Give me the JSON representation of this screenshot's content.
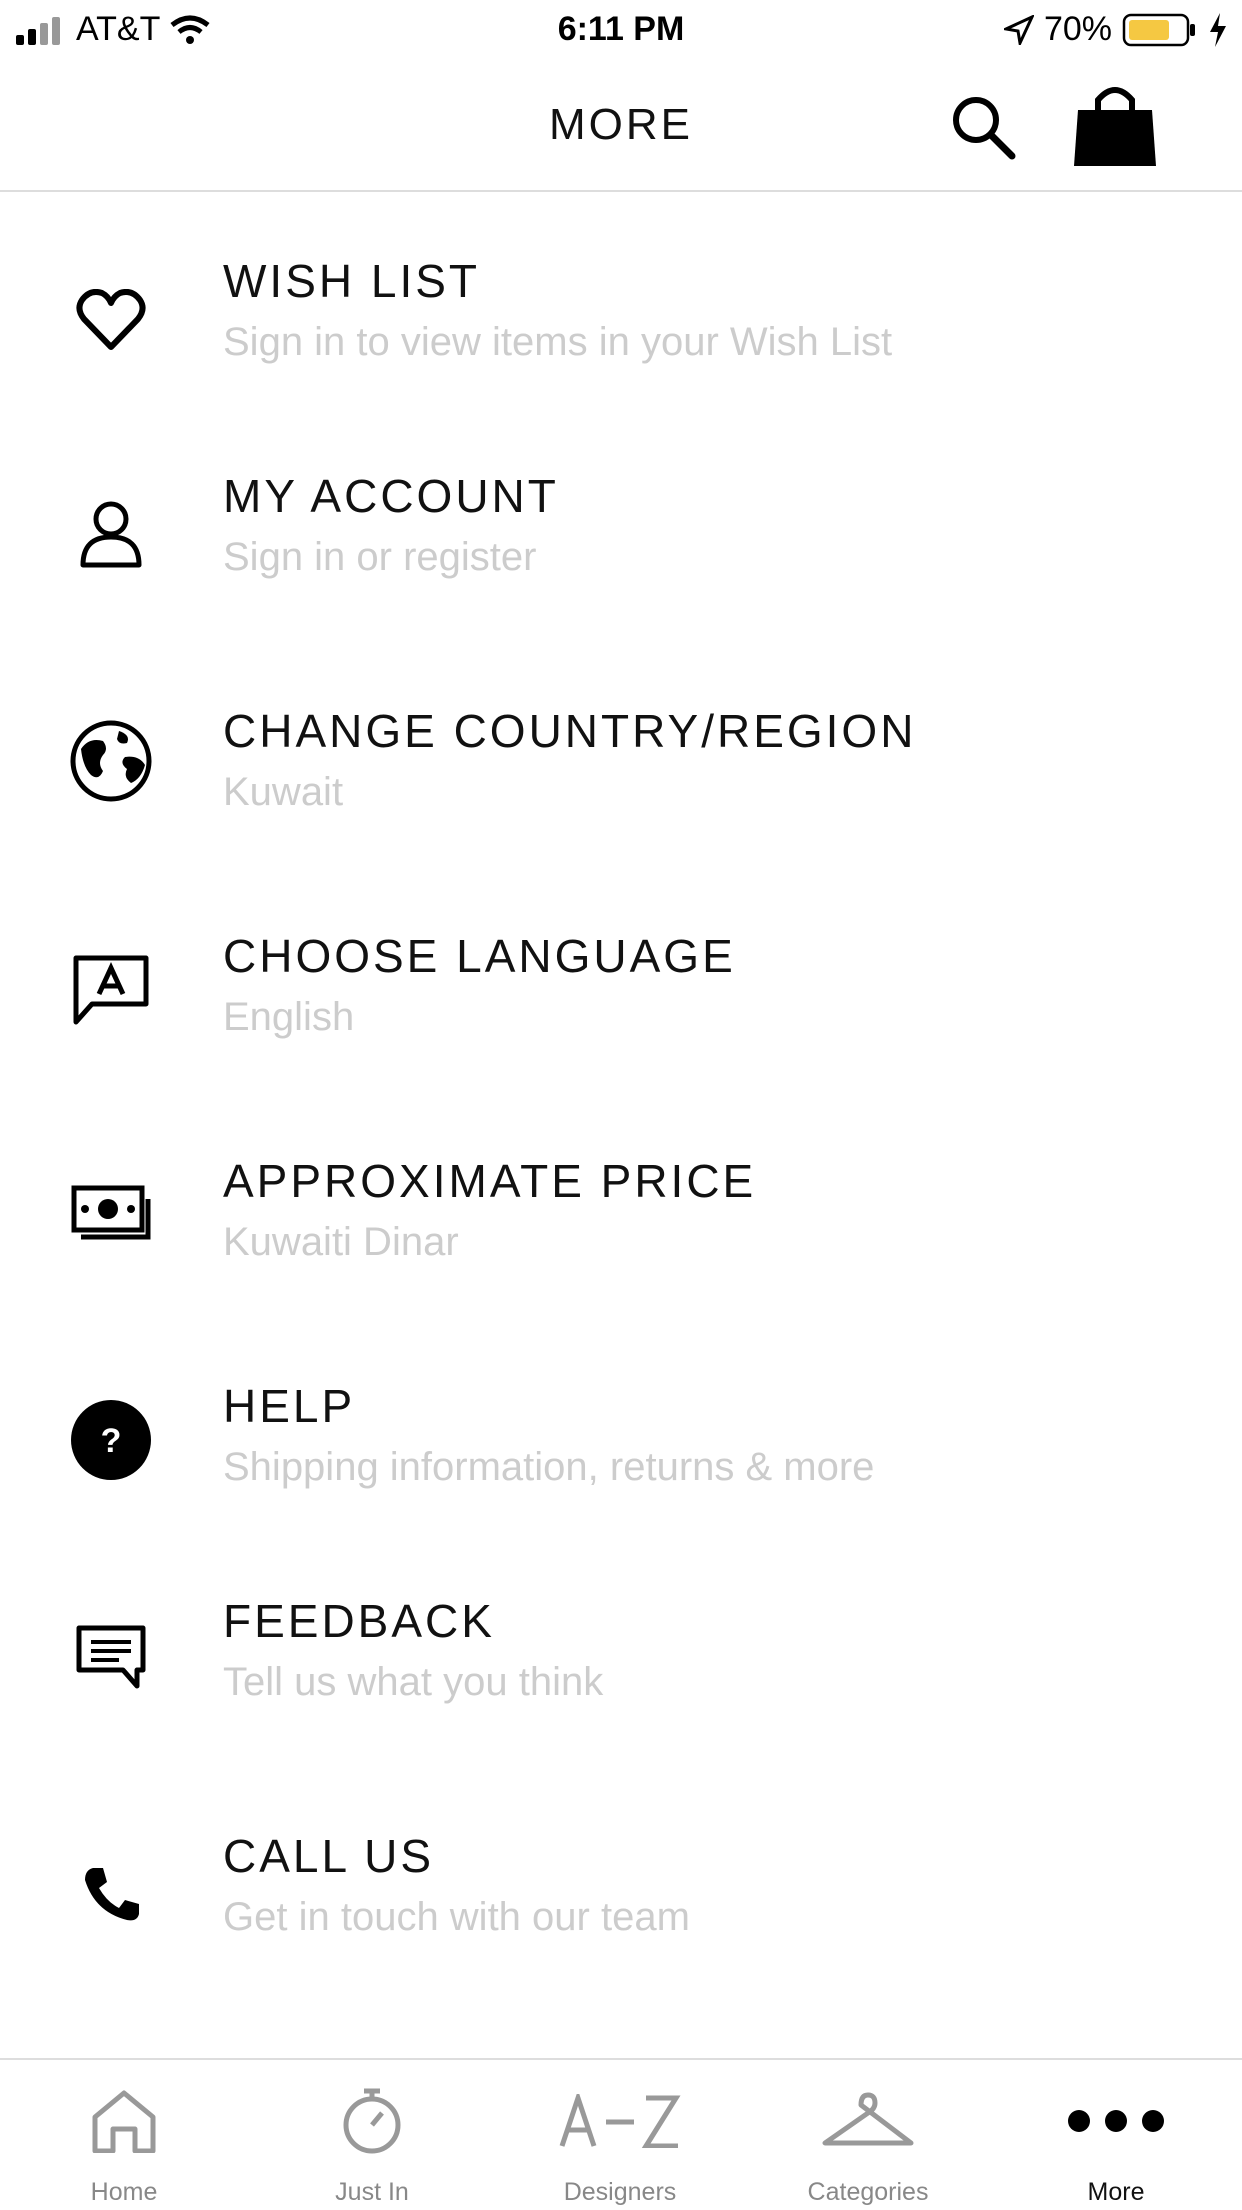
{
  "status_bar": {
    "carrier": "AT&T",
    "time": "6:11 PM",
    "battery": "70%",
    "battery_color": "#f5c842"
  },
  "header": {
    "title": "MORE",
    "search_icon": "search-icon",
    "bag_icon": "shopping-bag-icon"
  },
  "menu": {
    "items": [
      {
        "title": "WISH LIST",
        "subtitle": "Sign in to view items in your Wish List",
        "icon": "heart-icon"
      },
      {
        "title": "MY ACCOUNT",
        "subtitle": "Sign in or register",
        "icon": "person-icon"
      },
      {
        "title": "CHANGE COUNTRY/REGION",
        "subtitle": "Kuwait",
        "icon": "globe-icon"
      },
      {
        "title": "CHOOSE LANGUAGE",
        "subtitle": "English",
        "icon": "language-icon"
      },
      {
        "title": "APPROXIMATE PRICE",
        "subtitle": "Kuwaiti Dinar",
        "icon": "money-icon"
      },
      {
        "title": "HELP",
        "subtitle": "Shipping information, returns & more",
        "icon": "help-icon"
      },
      {
        "title": "FEEDBACK",
        "subtitle": "Tell us what you think",
        "icon": "feedback-icon"
      },
      {
        "title": "CALL US",
        "subtitle": "Get in touch with our team",
        "icon": "phone-icon"
      }
    ]
  },
  "tabs": [
    {
      "label": "Home",
      "icon": "home-icon",
      "active": false
    },
    {
      "label": "Just In",
      "icon": "stopwatch-icon",
      "active": false
    },
    {
      "label": "Designers",
      "icon": "a-z-icon",
      "active": false
    },
    {
      "label": "Categories",
      "icon": "hanger-icon",
      "active": false
    },
    {
      "label": "More",
      "icon": "more-dots-icon",
      "active": true
    }
  ]
}
